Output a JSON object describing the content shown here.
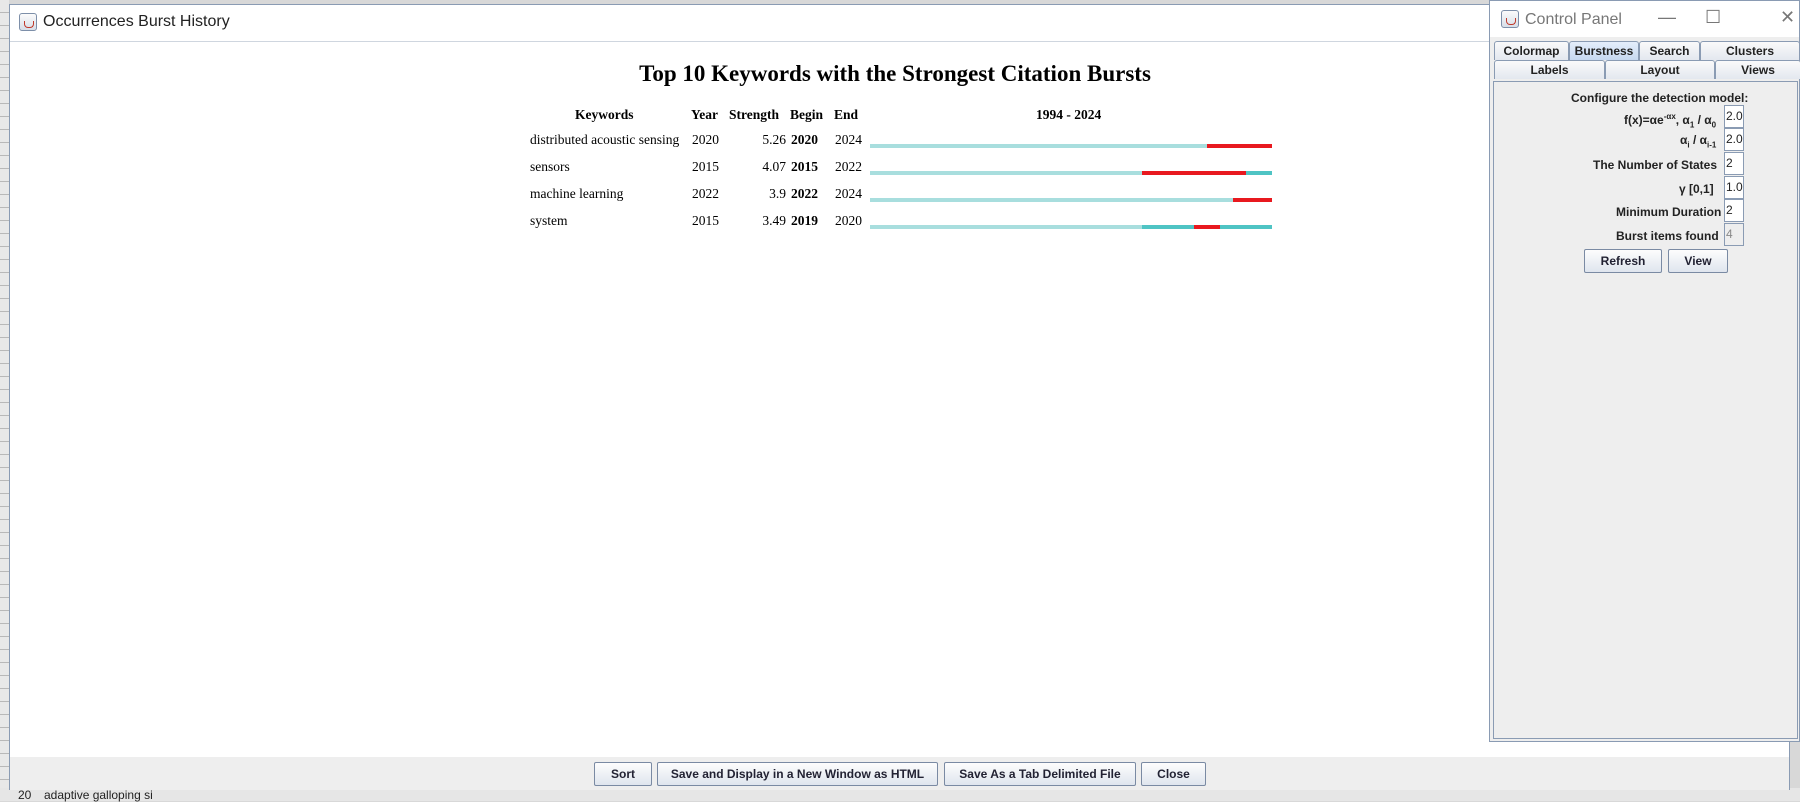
{
  "background": {
    "bottom_texts": [
      "20",
      "adaptive galloping si"
    ]
  },
  "main_window": {
    "title": "Occurrences Burst History",
    "heading": "Top 10 Keywords with the Strongest Citation Bursts",
    "columns": {
      "keywords": "Keywords",
      "year": "Year",
      "strength": "Strength",
      "begin": "Begin",
      "end": "End",
      "range": "1994 - 2024"
    },
    "rows": [
      {
        "keyword": "distributed acoustic sensing",
        "year": "2020",
        "strength": "5.26",
        "begin": "2020",
        "end": "2024"
      },
      {
        "keyword": "sensors",
        "year": "2015",
        "strength": "4.07",
        "begin": "2015",
        "end": "2022"
      },
      {
        "keyword": "machine learning",
        "year": "2022",
        "strength": "3.9",
        "begin": "2022",
        "end": "2024"
      },
      {
        "keyword": "system",
        "year": "2015",
        "strength": "3.49",
        "begin": "2019",
        "end": "2020"
      }
    ],
    "buttons": {
      "sort": "Sort",
      "save_html": "Save and Display in a New Window as HTML",
      "save_tab": "Save As a Tab Delimited File",
      "close": "Close"
    },
    "colors": {
      "burst": "#e8191f",
      "active": "#4fc4c4",
      "inactive": "#a8dede"
    }
  },
  "chart_data": {
    "type": "timeline",
    "title": "Top 10 Keywords with the Strongest Citation Bursts",
    "range": [
      1994,
      2024
    ],
    "series": [
      {
        "name": "distributed acoustic sensing",
        "active_from": 2020,
        "burst": [
          2020,
          2024
        ]
      },
      {
        "name": "sensors",
        "active_from": 2015,
        "burst": [
          2015,
          2022
        ]
      },
      {
        "name": "machine learning",
        "active_from": 2022,
        "burst": [
          2022,
          2024
        ]
      },
      {
        "name": "system",
        "active_from": 2015,
        "burst": [
          2019,
          2020
        ]
      }
    ]
  },
  "control_panel": {
    "title": "Control Panel",
    "tabs_row1": [
      "Colormap",
      "Burstness",
      "Search",
      "Clusters"
    ],
    "tabs_row2": [
      "Labels",
      "Layout",
      "Views"
    ],
    "selected_tab": "Burstness",
    "configure_label": "Configure the detection model:",
    "fx_label": "f(x)=αe",
    "fx_sup": "-αx",
    "fx_rest": ", α",
    "fx_sub1": "1",
    "fx_mid": " / α",
    "fx_sub0": "0",
    "fx_value": "2.0",
    "ratio_a": "α",
    "ratio_sub_i": "i",
    "ratio_mid": " / α",
    "ratio_sub_i1": "i-1",
    "ratio_value": "2.0",
    "states_label": "The Number of States",
    "states_value": "2",
    "gamma_label": "γ [0,1]",
    "gamma_value": "1.0",
    "duration_label": "Minimum Duration",
    "duration_value": "2",
    "found_label": "Burst items found",
    "found_value": "4",
    "refresh": "Refresh",
    "view": "View"
  }
}
